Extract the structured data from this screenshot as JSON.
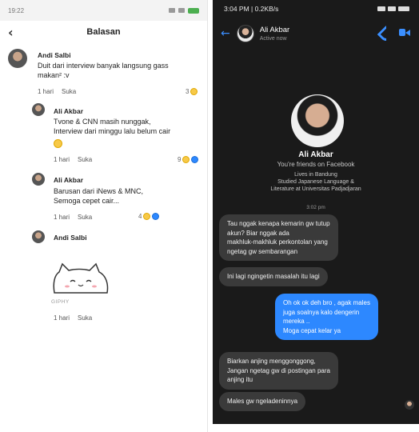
{
  "left": {
    "status_time": "19:22",
    "header_title": "Balasan",
    "comments": [
      {
        "name": "Andi Salbi",
        "lines": [
          "Duit dari interview banyak langsung gass",
          "makan² :v"
        ],
        "time": "1 hari",
        "like": "Suka",
        "reactions": "3"
      },
      {
        "name": "Ali Akbar",
        "lines": [
          "Tvone & CNN masih nunggak,",
          "Interview dari minggu lalu belum cair"
        ],
        "time": "1 hari",
        "like": "Suka",
        "reactions": "9"
      },
      {
        "name": "Ali Akbar",
        "lines": [
          "Barusan dari iNews & MNC,",
          "Semoga cepet cair..."
        ],
        "time": "1 hari",
        "like": "Suka",
        "reactions": "4"
      },
      {
        "name": "Andi Salbi",
        "giphy": "GIPHY",
        "time": "1 hari",
        "like": "Suka"
      }
    ]
  },
  "right": {
    "status_time": "3:04 PM",
    "status_speed": "0.2KB/s",
    "chat_name": "Ali Akbar",
    "chat_status": "Active now",
    "profile_name": "Ali Akbar",
    "profile_friends": "You're friends on Facebook",
    "profile_info": [
      "Lives in Bandung",
      "Studied Japanese Language &",
      "Literature at Universitas Padjadjaran"
    ],
    "time_separator": "3:02 pm",
    "messages": [
      {
        "dir": "in",
        "lines": [
          "Tau nggak kenapa kemarin gw tutup",
          "akun? Biar nggak ada",
          "makhluk-makhluk perkontolan yang",
          "ngetag gw sembarangan"
        ]
      },
      {
        "dir": "in",
        "lines": [
          "Ini lagi ngingetin masalah itu lagi"
        ]
      },
      {
        "dir": "out",
        "lines": [
          "Oh ok ok deh bro , agak males",
          "juga soalnya kalo dengerin",
          "mereka ..",
          "Moga cepat kelar ya"
        ]
      },
      {
        "dir": "in",
        "lines": [
          "Biarkan anjing menggonggong,",
          "Jangan ngetag gw di postingan para",
          "anjing itu"
        ]
      },
      {
        "dir": "in",
        "lines": [
          "Males gw ngeladeninnya"
        ]
      }
    ]
  },
  "colors": {
    "messenger_blue": "#2d88ff",
    "dark_bg": "#1a1a1a",
    "incoming_bubble": "#3a3a3a"
  }
}
